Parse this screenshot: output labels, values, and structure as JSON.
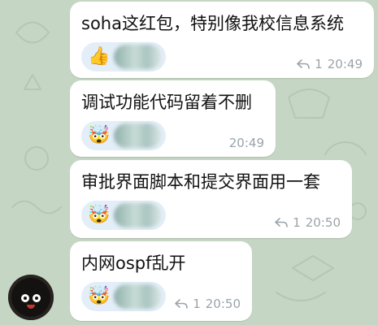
{
  "messages": [
    {
      "text": "soha这红包，特别像我校信息系统",
      "reaction_emoji": "👍",
      "reply_count": "1",
      "time": "20:49",
      "has_reply_icon": true
    },
    {
      "text": "调试功能代码留着不删",
      "reaction_emoji": "🤯",
      "reply_count": "",
      "time": "20:49",
      "has_reply_icon": false
    },
    {
      "text": "审批界面脚本和提交界面用一套",
      "reaction_emoji": "🤯",
      "reply_count": "1",
      "time": "20:50",
      "has_reply_icon": true
    },
    {
      "text": "内网ospf乱开",
      "reaction_emoji": "🤯",
      "reply_count": "1",
      "time": "20:50",
      "has_reply_icon": true
    }
  ],
  "colors": {
    "wallpaper": "#c6d6c4",
    "bubble": "#ffffff",
    "reaction_bg": "#e3eef8",
    "meta_text": "#9aa4aa"
  },
  "icons": {
    "reply": "reply-arrow-icon",
    "avatar": "soot-sprite-avatar"
  }
}
